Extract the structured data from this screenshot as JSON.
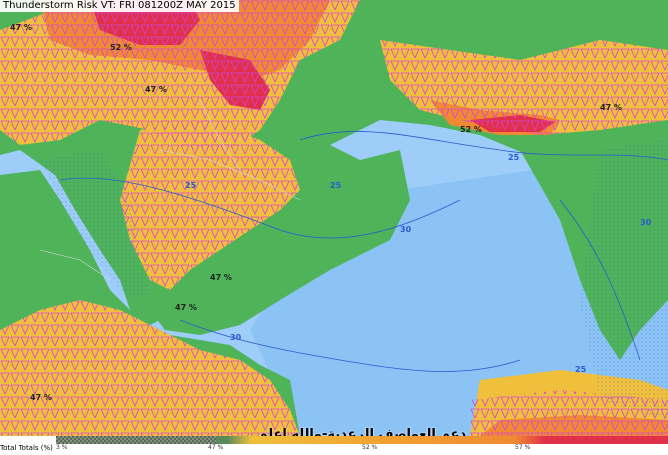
{
  "title": "Thunderstorm Risk VT: FRI 081200Z MAY 2015",
  "watermark": "دعم العواصف الرعدية-والله اعلم",
  "legend": {
    "label": "Total Totals (%)",
    "ticks": [
      "3 %",
      "47 %",
      "52 %",
      "57 %"
    ]
  },
  "map_labels": {
    "contour_low": "25",
    "contour_high": "30",
    "level_mid": "47 %",
    "level_high": "52 %"
  },
  "colors": {
    "sea": "#9dcdf8",
    "land_low": "#4fb35a",
    "risk_moderate": "#f0c03c",
    "risk_high": "#f08a32",
    "risk_severe": "#e0304a",
    "hatch": "#d63fd6"
  }
}
